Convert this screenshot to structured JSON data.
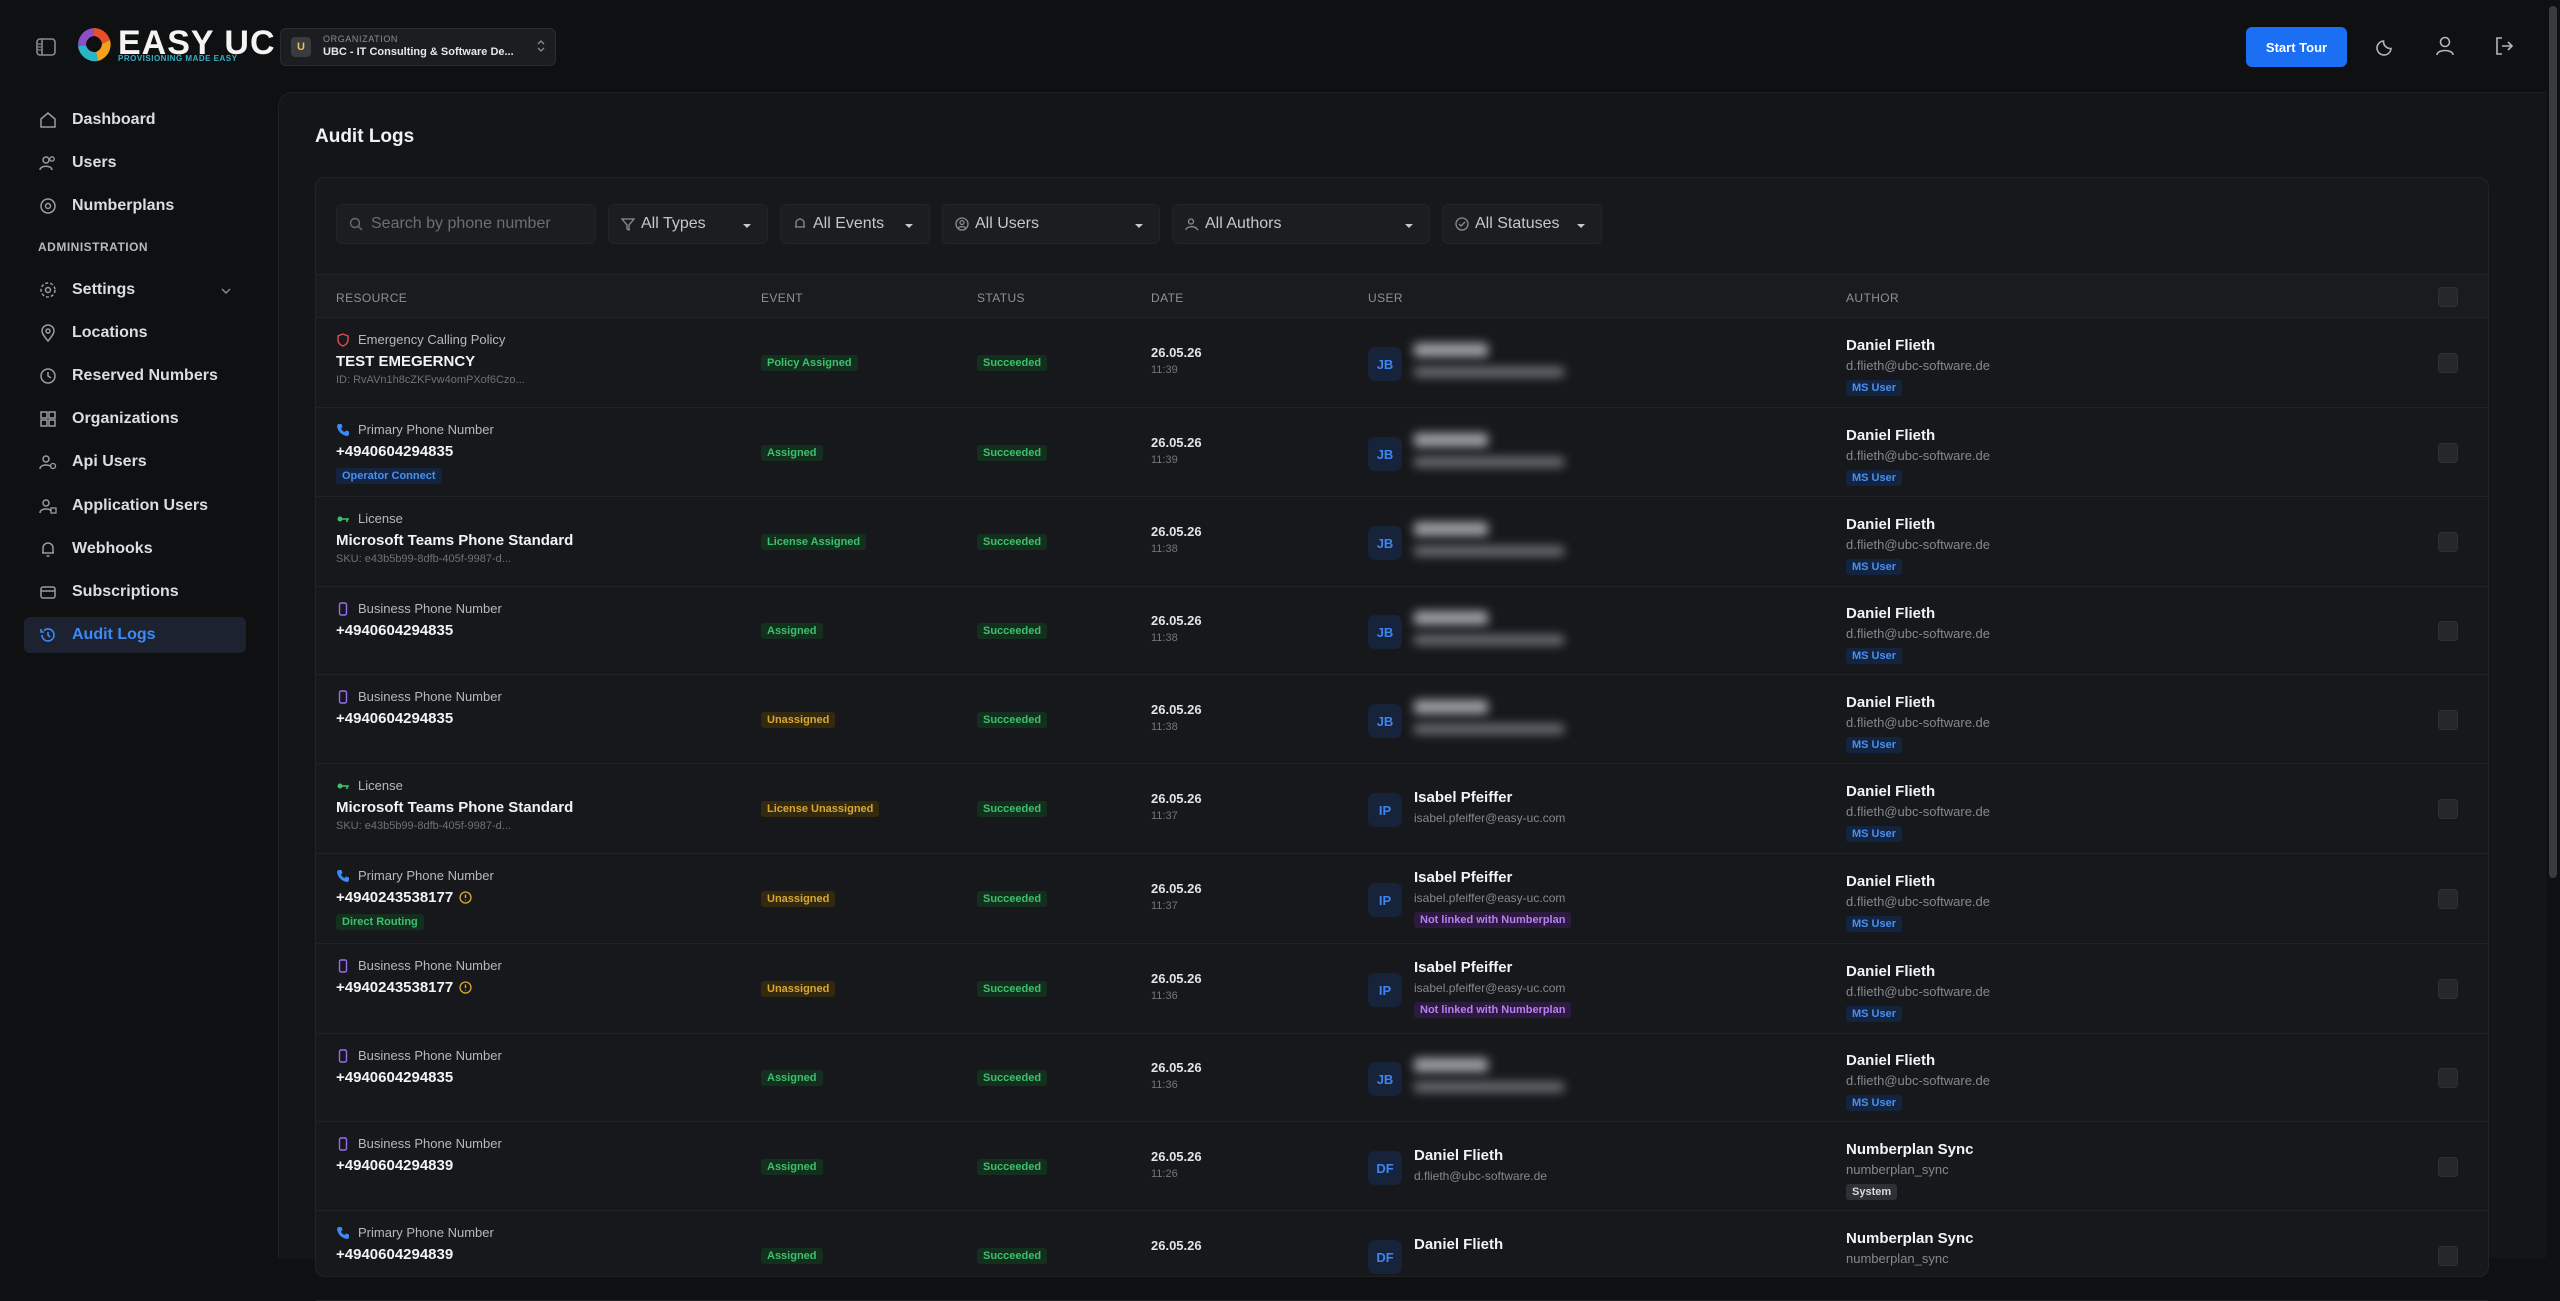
{
  "app": {
    "logo_text": "EASY UC",
    "logo_subtitle": "PROVISIONING MADE EASY",
    "organization_label": "ORGANIZATION",
    "organization_initial": "U",
    "organization_name": "UBC - IT Consulting & Software De...",
    "start_tour_label": "Start Tour"
  },
  "sidebar": {
    "items": [
      {
        "label": "Dashboard",
        "icon": "home-icon"
      },
      {
        "label": "Users",
        "icon": "users-icon"
      },
      {
        "label": "Numberplans",
        "icon": "numberplans-icon"
      }
    ],
    "section_label": "ADMINISTRATION",
    "admin_items": [
      {
        "label": "Settings",
        "icon": "settings-icon"
      },
      {
        "label": "Locations",
        "icon": "location-pin-icon"
      },
      {
        "label": "Reserved Numbers",
        "icon": "reserved-numbers-icon"
      },
      {
        "label": "Organizations",
        "icon": "organizations-icon"
      },
      {
        "label": "Api Users",
        "icon": "api-users-icon"
      },
      {
        "label": "Application Users",
        "icon": "application-users-icon"
      },
      {
        "label": "Webhooks",
        "icon": "bell-icon"
      },
      {
        "label": "Subscriptions",
        "icon": "subscriptions-icon"
      },
      {
        "label": "Audit Logs",
        "icon": "history-icon",
        "active": true
      }
    ]
  },
  "page": {
    "title": "Audit Logs"
  },
  "filters": {
    "search_placeholder": "Search by phone number",
    "types": "All Types",
    "events": "All Events",
    "users": "All Users",
    "authors": "All Authors",
    "statuses": "All Statuses"
  },
  "table": {
    "headers": {
      "resource": "RESOURCE",
      "event": "EVENT",
      "status": "STATUS",
      "date": "DATE",
      "user": "USER",
      "author": "AUTHOR"
    },
    "rows": [
      {
        "type": "Emergency Calling Policy",
        "name": "TEST EMEGERNCY",
        "sub": "ID: RvAVn1h8cZKFvw4omPXof6Czo...",
        "event": "Policy Assigned",
        "status": "Succeeded",
        "date": "26.05.26",
        "time": "11:39",
        "user_initials": "JB",
        "author": "Daniel Flieth",
        "author_sub": "d.flieth@ubc-software.de",
        "author_tag": "MS User"
      },
      {
        "type": "Primary Phone Number",
        "name": "+4940604294835",
        "res_tag": "Operator Connect",
        "event": "Assigned",
        "status": "Succeeded",
        "date": "26.05.26",
        "time": "11:39",
        "user_initials": "JB",
        "author": "Daniel Flieth",
        "author_sub": "d.flieth@ubc-software.de",
        "author_tag": "MS User"
      },
      {
        "type": "License",
        "name": "Microsoft Teams Phone Standard",
        "sub": "SKU: e43b5b99-8dfb-405f-9987-d...",
        "event": "License Assigned",
        "status": "Succeeded",
        "date": "26.05.26",
        "time": "11:38",
        "user_initials": "JB",
        "author": "Daniel Flieth",
        "author_sub": "d.flieth@ubc-software.de",
        "author_tag": "MS User"
      },
      {
        "type": "Business Phone Number",
        "name": "+4940604294835",
        "event": "Assigned",
        "status": "Succeeded",
        "date": "26.05.26",
        "time": "11:38",
        "user_initials": "JB",
        "author": "Daniel Flieth",
        "author_sub": "d.flieth@ubc-software.de",
        "author_tag": "MS User"
      },
      {
        "type": "Business Phone Number",
        "name": "+4940604294835",
        "event": "Unassigned",
        "status": "Succeeded",
        "date": "26.05.26",
        "time": "11:38",
        "user_initials": "JB",
        "author": "Daniel Flieth",
        "author_sub": "d.flieth@ubc-software.de",
        "author_tag": "MS User"
      },
      {
        "type": "License",
        "name": "Microsoft Teams Phone Standard",
        "sub": "SKU: e43b5b99-8dfb-405f-9987-d...",
        "event": "License Unassigned",
        "status": "Succeeded",
        "date": "26.05.26",
        "time": "11:37",
        "user_initials": "IP",
        "user_name": "Isabel Pfeiffer",
        "user_email": "isabel.pfeiffer@easy-uc.com",
        "author": "Daniel Flieth",
        "author_sub": "d.flieth@ubc-software.de",
        "author_tag": "MS User"
      },
      {
        "type": "Primary Phone Number",
        "name": "+4940243538177",
        "res_tag": "Direct Routing",
        "event": "Unassigned",
        "status": "Succeeded",
        "date": "26.05.26",
        "time": "11:37",
        "user_initials": "IP",
        "user_name": "Isabel Pfeiffer",
        "user_email": "isabel.pfeiffer@easy-uc.com",
        "user_tag": "Not linked with Numberplan",
        "author": "Daniel Flieth",
        "author_sub": "d.flieth@ubc-software.de",
        "author_tag": "MS User"
      },
      {
        "type": "Business Phone Number",
        "name": "+4940243538177",
        "event": "Unassigned",
        "status": "Succeeded",
        "date": "26.05.26",
        "time": "11:36",
        "user_initials": "IP",
        "user_name": "Isabel Pfeiffer",
        "user_email": "isabel.pfeiffer@easy-uc.com",
        "user_tag": "Not linked with Numberplan",
        "author": "Daniel Flieth",
        "author_sub": "d.flieth@ubc-software.de",
        "author_tag": "MS User"
      },
      {
        "type": "Business Phone Number",
        "name": "+4940604294835",
        "event": "Assigned",
        "status": "Succeeded",
        "date": "26.05.26",
        "time": "11:36",
        "user_initials": "JB",
        "author": "Daniel Flieth",
        "author_sub": "d.flieth@ubc-software.de",
        "author_tag": "MS User"
      },
      {
        "type": "Business Phone Number",
        "name": "+4940604294839",
        "event": "Assigned",
        "status": "Succeeded",
        "date": "26.05.26",
        "time": "11:26",
        "user_initials": "DF",
        "user_name": "Daniel Flieth",
        "user_email": "d.flieth@ubc-software.de",
        "author": "Numberplan Sync",
        "author_sub": "numberplan_sync",
        "author_tag": "System"
      },
      {
        "type": "Primary Phone Number",
        "name": "+4940604294839",
        "event": "Assigned",
        "status": "Succeeded",
        "date": "26.05.26",
        "time": "",
        "user_initials": "DF",
        "user_name": "Daniel Flieth",
        "author": "Numberplan Sync",
        "author_sub": "numberplan_sync"
      }
    ]
  },
  "colors": {
    "accent": "#1a6ff2",
    "success": "#3fbf6c",
    "warning": "#d9a735",
    "purple": "#b77ff0"
  }
}
